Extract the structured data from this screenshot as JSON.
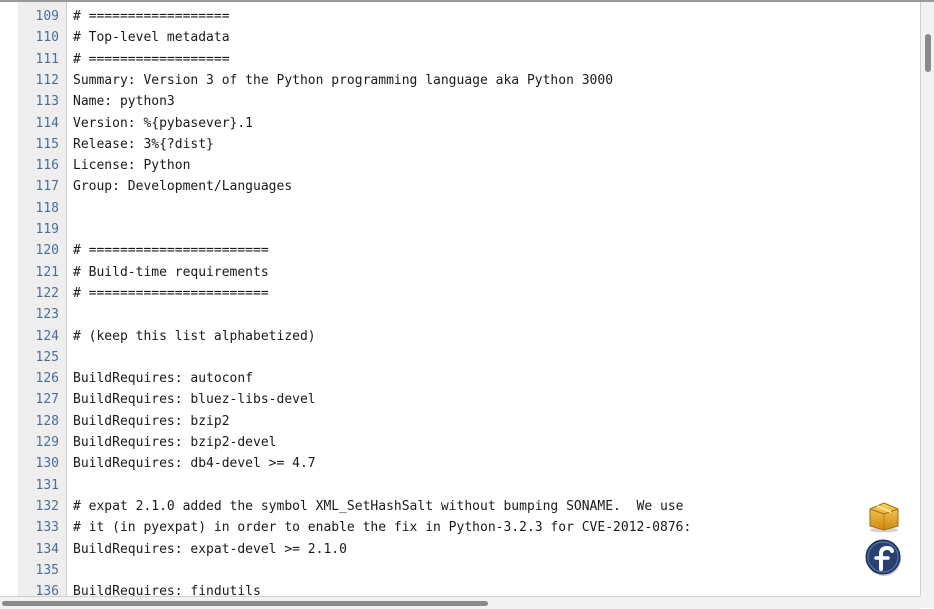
{
  "editor": {
    "lines": [
      {
        "num": "109",
        "text": "# =================="
      },
      {
        "num": "110",
        "text": "# Top-level metadata"
      },
      {
        "num": "111",
        "text": "# =================="
      },
      {
        "num": "112",
        "text": "Summary: Version 3 of the Python programming language aka Python 3000"
      },
      {
        "num": "113",
        "text": "Name: python3"
      },
      {
        "num": "114",
        "text": "Version: %{pybasever}.1"
      },
      {
        "num": "115",
        "text": "Release: 3%{?dist}"
      },
      {
        "num": "116",
        "text": "License: Python"
      },
      {
        "num": "117",
        "text": "Group: Development/Languages"
      },
      {
        "num": "118",
        "text": ""
      },
      {
        "num": "119",
        "text": ""
      },
      {
        "num": "120",
        "text": "# ======================="
      },
      {
        "num": "121",
        "text": "# Build-time requirements"
      },
      {
        "num": "122",
        "text": "# ======================="
      },
      {
        "num": "123",
        "text": ""
      },
      {
        "num": "124",
        "text": "# (keep this list alphabetized)"
      },
      {
        "num": "125",
        "text": ""
      },
      {
        "num": "126",
        "text": "BuildRequires: autoconf"
      },
      {
        "num": "127",
        "text": "BuildRequires: bluez-libs-devel"
      },
      {
        "num": "128",
        "text": "BuildRequires: bzip2"
      },
      {
        "num": "129",
        "text": "BuildRequires: bzip2-devel"
      },
      {
        "num": "130",
        "text": "BuildRequires: db4-devel >= 4.7"
      },
      {
        "num": "131",
        "text": ""
      },
      {
        "num": "132",
        "text": "# expat 2.1.0 added the symbol XML_SetHashSalt without bumping SONAME.  We use"
      },
      {
        "num": "133",
        "text": "# it (in pyexpat) in order to enable the fix in Python-3.2.3 for CVE-2012-0876:"
      },
      {
        "num": "134",
        "text": "BuildRequires: expat-devel >= 2.1.0"
      },
      {
        "num": "135",
        "text": ""
      },
      {
        "num": "136",
        "text": "BuildRequires: findutils"
      }
    ]
  },
  "dock": {
    "package_icon": "package-box-icon",
    "fedora_icon": "fedora-logo-icon"
  },
  "colors": {
    "gutter_bg": "#eeeeee",
    "line_number": "#4a6f97",
    "text": "#1a1a1a",
    "fedora_blue": "#294172",
    "package_gold": "#e5a828"
  }
}
